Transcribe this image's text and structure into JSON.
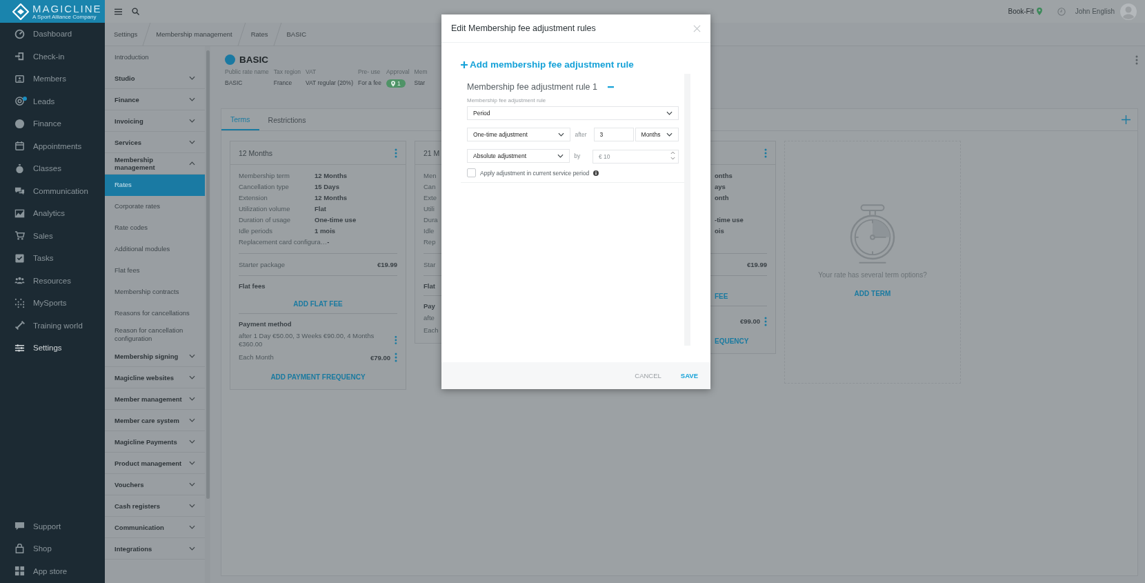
{
  "brand": {
    "name": "MAGICLINE",
    "tagline": "A Sport Alliance Company"
  },
  "nav": {
    "items": [
      {
        "label": "Dashboard",
        "selected": false,
        "notification": false
      },
      {
        "label": "Check-in",
        "selected": false,
        "notification": false
      },
      {
        "label": "Members",
        "selected": false,
        "notification": false
      },
      {
        "label": "Leads",
        "selected": false,
        "notification": true
      },
      {
        "label": "Finance",
        "selected": false,
        "notification": false
      },
      {
        "label": "Appointments",
        "selected": false,
        "notification": false
      },
      {
        "label": "Classes",
        "selected": false,
        "notification": false
      },
      {
        "label": "Communication",
        "selected": false,
        "notification": false
      },
      {
        "label": "Analytics",
        "selected": false,
        "notification": false
      },
      {
        "label": "Sales",
        "selected": false,
        "notification": false
      },
      {
        "label": "Tasks",
        "selected": false,
        "notification": false
      },
      {
        "label": "Resources",
        "selected": false,
        "notification": false
      },
      {
        "label": "MySports",
        "selected": false,
        "notification": false
      },
      {
        "label": "Training world",
        "selected": false,
        "notification": false
      },
      {
        "label": "Settings",
        "selected": true,
        "notification": false
      }
    ],
    "bottom_items": [
      {
        "label": "Support"
      },
      {
        "label": "Shop"
      },
      {
        "label": "App store"
      }
    ]
  },
  "header": {
    "studio": "Book-Fit",
    "user": "John English"
  },
  "breadcrumb": [
    "Settings",
    "Membership management",
    "Rates",
    "BASIC"
  ],
  "settings_menu": [
    {
      "label": "Introduction",
      "kind": "link",
      "selected": false
    },
    {
      "label": "Studio",
      "kind": "group",
      "expanded": false
    },
    {
      "label": "Finance",
      "kind": "group",
      "expanded": false
    },
    {
      "label": "Invoicing",
      "kind": "group",
      "expanded": false
    },
    {
      "label": "Services",
      "kind": "group",
      "expanded": false
    },
    {
      "label": "Membership management",
      "kind": "group",
      "expanded": true,
      "children": [
        {
          "label": "Rates",
          "selected": true
        },
        {
          "label": "Corporate rates",
          "selected": false
        },
        {
          "label": "Rate codes",
          "selected": false
        },
        {
          "label": "Additional modules",
          "selected": false
        },
        {
          "label": "Flat fees",
          "selected": false
        },
        {
          "label": "Membership contracts",
          "selected": false
        },
        {
          "label": "Reasons for cancellations",
          "selected": false
        },
        {
          "label": "Reason for cancellation configuration",
          "selected": false
        }
      ]
    },
    {
      "label": "Membership signing",
      "kind": "group",
      "expanded": false
    },
    {
      "label": "Magicline websites",
      "kind": "group",
      "expanded": false
    },
    {
      "label": "Member management",
      "kind": "group",
      "expanded": false
    },
    {
      "label": "Member care system",
      "kind": "group",
      "expanded": false
    },
    {
      "label": "Magicline Payments",
      "kind": "group",
      "expanded": false
    },
    {
      "label": "Product management",
      "kind": "group",
      "expanded": false
    },
    {
      "label": "Vouchers",
      "kind": "group",
      "expanded": false
    },
    {
      "label": "Cash registers",
      "kind": "group",
      "expanded": false
    },
    {
      "label": "Communication",
      "kind": "group",
      "expanded": false
    },
    {
      "label": "Integrations",
      "kind": "group",
      "expanded": false
    }
  ],
  "rate": {
    "name": "BASIC",
    "fields": [
      {
        "label": "Public rate name",
        "value": "BASIC",
        "kind": "text"
      },
      {
        "label": "Tax region",
        "value": "France",
        "kind": "text"
      },
      {
        "label": "VAT",
        "value": "VAT regular (20%)",
        "kind": "text"
      },
      {
        "label": "Pre- use",
        "value": "For a fee",
        "kind": "text"
      },
      {
        "label": "Approval",
        "value": "1",
        "kind": "badge"
      },
      {
        "label": "Mem",
        "value": "Star",
        "kind": "text"
      }
    ]
  },
  "tabs": [
    {
      "label": "Terms",
      "selected": true
    },
    {
      "label": "Restrictions",
      "selected": false
    }
  ],
  "cards": [
    {
      "kind": "full",
      "title": "12 Months",
      "menu": true,
      "rows": [
        {
          "label": "Membership term",
          "value": "12 Months"
        },
        {
          "label": "Cancellation type",
          "value": "15 Days"
        },
        {
          "label": "Extension",
          "value": "12 Months"
        },
        {
          "label": "Utilization volume",
          "value": "Flat"
        },
        {
          "label": "Duration of usage",
          "value": "One-time use"
        },
        {
          "label": "Idle periods",
          "value": "1 mois"
        },
        {
          "label": "Replacement card configura…",
          "value": "-"
        }
      ],
      "starter": {
        "label": "Starter package",
        "value": "€19.99"
      },
      "flat_fees": {
        "title": "Flat fees",
        "action": "ADD FLAT FEE"
      },
      "payment": {
        "title": "Payment method",
        "items": [
          {
            "label": "after 1 Day €50.00, 3 Weeks €90.00, 4 Months €360.00",
            "menu": true
          },
          {
            "label": "Each Month",
            "value": "€79.00",
            "menu": true
          }
        ],
        "action": "ADD PAYMENT FREQUENCY"
      }
    },
    {
      "kind": "right-hidden",
      "title": "21 M",
      "menu": false,
      "rows": [
        {
          "label": "Men"
        },
        {
          "label": "Can"
        },
        {
          "label": "Exte"
        },
        {
          "label": "Utili"
        },
        {
          "label": "Dura"
        },
        {
          "label": "Idle"
        },
        {
          "label": "Rep"
        }
      ],
      "starter": {
        "label": "Star"
      },
      "flat_fees": {
        "title": "Flat"
      },
      "payment": {
        "title": "Pay",
        "items": [
          {
            "label": "afte",
            "menu": false
          },
          {
            "label": "Each",
            "menu": false
          }
        ]
      }
    },
    {
      "kind": "left-hidden",
      "menu": true,
      "rows": [
        {
          "value": "onths"
        },
        {
          "value": "ays"
        },
        {
          "value": "onth"
        },
        {},
        {
          "value": "-time use"
        },
        {
          "value": "ois"
        },
        {}
      ],
      "starter": {
        "value": "€19.99"
      },
      "flat_fees": {
        "action": "FEE"
      },
      "payment": {
        "items": [
          {
            "value": "€99.00",
            "menu": true
          }
        ],
        "action": "EQUENCY"
      }
    }
  ],
  "empty_card": {
    "message": "Your rate has several term options?",
    "action": "ADD TERM"
  },
  "modal": {
    "title": "Edit Membership fee adjustment rules",
    "add_rule": "Add membership fee adjustment rule",
    "rules": [
      {
        "title": "Membership fee adjustment rule 1",
        "field_label": "Membership fee adjustment rule",
        "type": "Period",
        "mode": "One-time adjustment",
        "after_label": "after",
        "after_value": "3",
        "unit": "Months",
        "adjustment": "Absolute adjustment",
        "by_label": "by",
        "amount_placeholder": "€ 10",
        "apply_current": {
          "label": "Apply adjustment in current service period",
          "checked": false
        }
      }
    ],
    "cancel": "CANCEL",
    "save": "SAVE"
  }
}
